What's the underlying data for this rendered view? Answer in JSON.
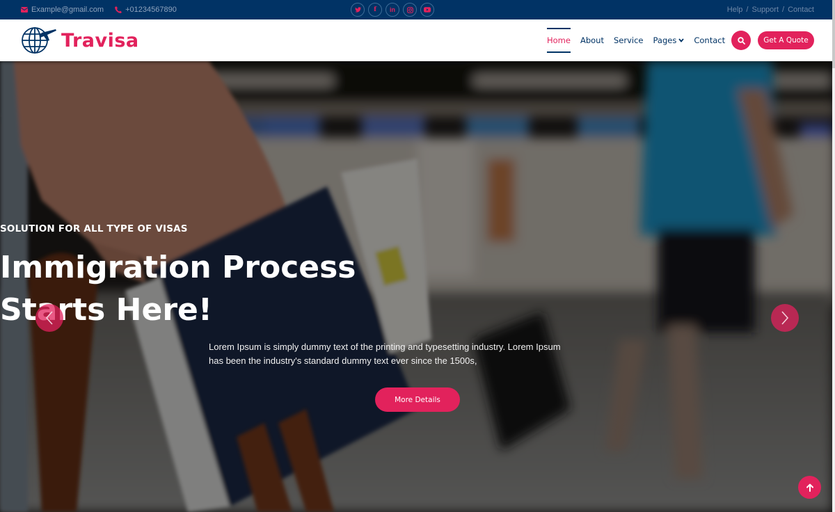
{
  "topbar": {
    "email": "Example@gmail.com",
    "phone": "+01234567890",
    "social": [
      {
        "name": "twitter",
        "glyph": "t"
      },
      {
        "name": "facebook",
        "glyph": "f"
      },
      {
        "name": "linkedin",
        "glyph": "in"
      },
      {
        "name": "instagram",
        "glyph": "◎"
      },
      {
        "name": "youtube",
        "glyph": "▶"
      }
    ],
    "links": [
      "Help",
      "Support",
      "Contact"
    ],
    "separator": "/"
  },
  "header": {
    "logo_text": "Travisa",
    "nav": [
      {
        "label": "Home",
        "active": true
      },
      {
        "label": "About"
      },
      {
        "label": "Service"
      },
      {
        "label": "Pages",
        "dropdown": true
      },
      {
        "label": "Contact"
      }
    ],
    "quote_label": "Get A Quote"
  },
  "hero": {
    "eyebrow": "SOLUTION FOR ALL TYPE OF VISAS",
    "title_line1": "Immigration Process",
    "title_line2": "Starts Here!",
    "description_line1": "Lorem Ipsum is simply dummy text of the printing and typesetting industry. Lorem Ipsum",
    "description_line2": "has been the industry's standard dummy text ever since the 1500s,",
    "button_label": "More Details"
  },
  "colors": {
    "brand_navy": "#013365",
    "accent_pink": "#e2225c"
  }
}
